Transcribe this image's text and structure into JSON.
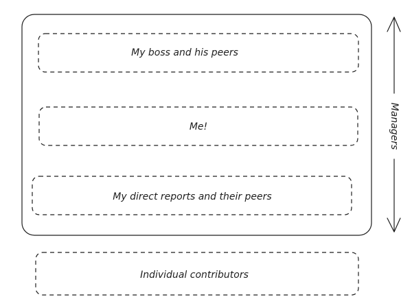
{
  "layers": {
    "boss": "My boss and his peers",
    "me": "Me!",
    "reports": "My direct reports and their peers",
    "ic": "Individual contributors"
  },
  "axis": {
    "label": "Managers"
  }
}
